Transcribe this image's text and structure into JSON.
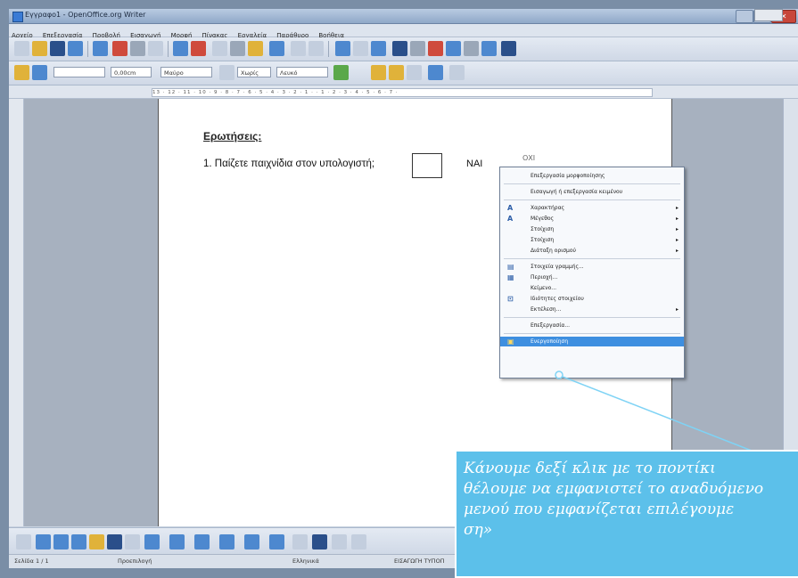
{
  "window": {
    "title": "Εγγραφο1 - OpenOffice.org Writer"
  },
  "menubar": [
    "Αρχείο",
    "Επεξεργασία",
    "Προβολή",
    "Εισαγωγή",
    "Μορφή",
    "Πίνακας",
    "Εργαλεία",
    "Παράθυρο",
    "Βοήθεια"
  ],
  "toolbar2": {
    "width_value": "0,00cm",
    "color_value": "Μαύρο",
    "style_value": "Χωρίς",
    "fill_value": "Λευκό"
  },
  "ruler": {
    "scale_text": "13 · 12 · 11 · 10 · 9 · 8 · 7 · 6 · 5 · 4 · 3 · 2 · 1 · · 1 · 2 · 3 · 4 · 5 · 6 · 7 ·"
  },
  "document": {
    "heading": "Ερωτήσεις:",
    "question": "1. Παίζετε παιχνίδια στον υπολογιστή;",
    "yes_label": "ΝΑΙ",
    "no_label": "ΟΧΙ"
  },
  "context_menu": {
    "items": [
      "Επεξεργασία μορφοποίησης",
      "Εισαγωγή ή επεξεργασία κειμένου",
      "Χαρακτήρας",
      "Μέγεθος",
      "Στοίχιση",
      "Στοίχιση",
      "Διάταξη ορισμού",
      "Στοιχεία γραμμής...",
      "Περιοχή...",
      "Κείμενο...",
      "Ιδιότητες στοιχείου",
      "Εκτέλεση...",
      "Επεξεργασία...",
      "Ενεργοποίηση"
    ],
    "highlighted": "Ενεργοποίηση"
  },
  "statusbar": {
    "page": "Σελίδα 1 / 1",
    "style": "Προεπιλογή",
    "language": "Ελληνικά",
    "mode": "ΕΙΣΑΓΩΓΗ ΤΥΠΟΠ"
  },
  "annotation": {
    "line1": "Κάνουμε δεξί κλικ με το ποντίκι",
    "line2": "θέλουμε να εμφανιστεί το αναδυόμενο",
    "line3": "μενού που εμφανίζεται επιλέγουμε",
    "line4": "ση»"
  },
  "colors": {
    "annotation_bg": "#5cc0ea",
    "menu_highlight": "#3e8fe0"
  }
}
